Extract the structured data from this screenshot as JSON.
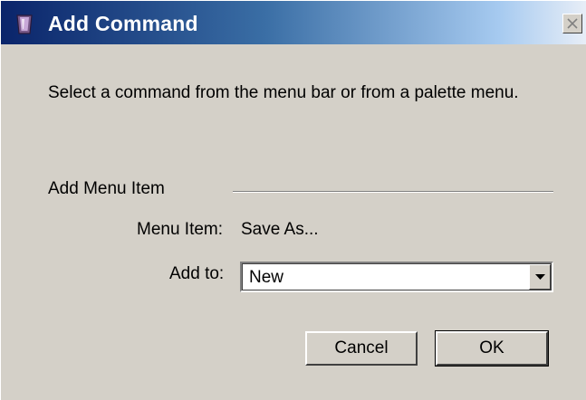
{
  "window": {
    "title": "Add Command"
  },
  "dialog": {
    "instruction": "Select a command from the menu bar or from a palette menu.",
    "group_label": "Add Menu Item",
    "menu_item_label": "Menu Item:",
    "menu_item_value": "Save As...",
    "add_to_label": "Add to:",
    "add_to_value": "New"
  },
  "buttons": {
    "cancel_label": "Cancel",
    "ok_label": "OK"
  },
  "icons": {
    "app": "app-icon",
    "close": "close-icon",
    "dropdown": "chevron-down-icon"
  },
  "colors": {
    "titlebar_start": "#0a246a",
    "titlebar_end": "#a6caf0",
    "dialog_bg": "#d4d0c8"
  }
}
